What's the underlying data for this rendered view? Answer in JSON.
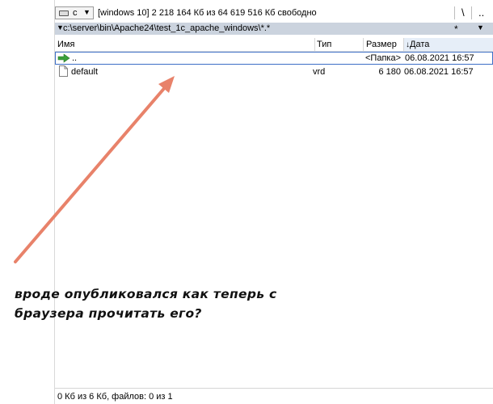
{
  "drive_bar": {
    "drive_letter": "c",
    "drive_info": "[windows 10]  2 218 164 Кб из 64 619 516 Кб свободно",
    "root_label": "\\",
    "up_label": ".."
  },
  "path_bar": {
    "path": "c:\\server\\bin\\Apache24\\test_1c_apache_windows\\*.*",
    "filter_label": "*"
  },
  "columns": {
    "name": "Имя",
    "type": "Тип",
    "size": "Размер",
    "date": "Дата"
  },
  "files": [
    {
      "name": "..",
      "type": "",
      "size": "<Папка>",
      "date": "06.08.2021 16:57",
      "icon": "up-arrow-icon"
    },
    {
      "name": "default",
      "type": "vrd",
      "size": "6 180",
      "date": "06.08.2021 16:57",
      "icon": "file-icon"
    }
  ],
  "status_bar": {
    "text": "0 Кб из 6 Кб, файлов: 0 из 1"
  },
  "annotation": {
    "line1": "вроде опубликовался как теперь с",
    "line2": "браузера прочитать его?",
    "arrow_color": "#e8826a"
  },
  "colors": {
    "path_bar_bg": "#cbd3de",
    "selection_border": "#3d6fc6",
    "arrow_green": "#3aa03a"
  }
}
